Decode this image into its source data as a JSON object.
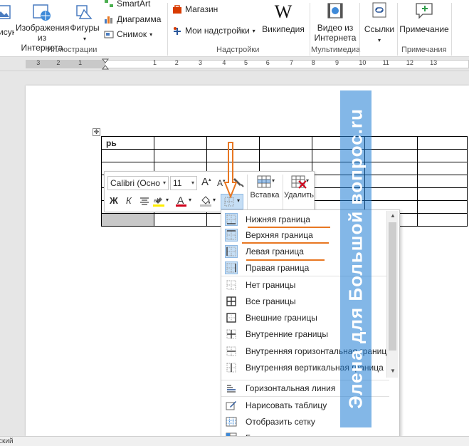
{
  "ribbon": {
    "illustrations": {
      "images_label": "Изображения\nиз Интернета",
      "left_label": "Рисунки",
      "shapes_label": "Фигуры",
      "smartart_label": "SmartArt",
      "chart_label": "Диаграмма",
      "screenshot_label": "Снимок",
      "group_label": "Иллюстрации"
    },
    "addins": {
      "store_label": "Магазин",
      "myaddins_label": "Мои надстройки",
      "wikipedia_label": "Википедия",
      "group_label": "Надстройки"
    },
    "media": {
      "video_label": "Видео из\nИнтернета",
      "group_label": "Мультимедиа"
    },
    "links": {
      "links_label": "Ссылки"
    },
    "comments": {
      "comment_label": "Примечание",
      "group_label": "Примечания"
    }
  },
  "ruler": {
    "numbers": [
      "3",
      "2",
      "1",
      "1",
      "2",
      "3",
      "4",
      "5",
      "6",
      "7",
      "8",
      "9",
      "10",
      "11",
      "12",
      "13"
    ]
  },
  "table": {
    "cell_text": "рь"
  },
  "mini_toolbar": {
    "font_name": "Calibri (Осно",
    "font_size": "11",
    "grow_label": "A",
    "shrink_label": "A",
    "bold_label": "Ж",
    "italic_label": "К",
    "font_color_label": "A",
    "insert_label": "Вставка",
    "delete_label": "Удалить"
  },
  "borders_menu": {
    "items": [
      {
        "label": "Нижняя граница"
      },
      {
        "label": "Верхняя граница"
      },
      {
        "label": "Левая граница"
      },
      {
        "label": "Правая граница"
      },
      {
        "label": "Нет границы"
      },
      {
        "label": "Все границы"
      },
      {
        "label": "Внешние границы"
      },
      {
        "label": "Внутренние границы"
      },
      {
        "label": "Внутренняя горизонтальная граница"
      },
      {
        "label": "Внутренняя вертикальная граница"
      },
      {
        "label": "Горизонтальная линия"
      },
      {
        "label": "Нарисовать таблицу"
      },
      {
        "label": "Отобразить сетку"
      },
      {
        "label": "Границы и заливка..."
      }
    ]
  },
  "watermark": {
    "text": "Элена для Большой вопрос.ru"
  },
  "status": {
    "language": "ский"
  },
  "colors": {
    "accent_orange": "#e87722",
    "watermark_blue": "#1e7bd4",
    "font_red": "#d0021b",
    "highlight_yellow": "#ffee00"
  }
}
